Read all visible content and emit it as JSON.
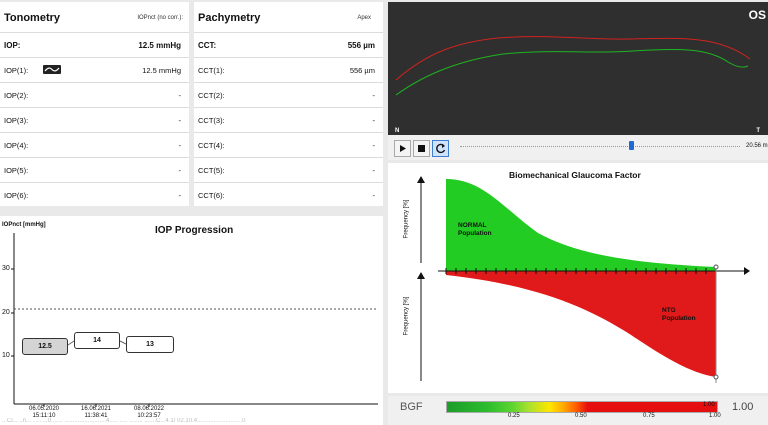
{
  "tonometry": {
    "title": "Tonometry",
    "subtitle": "IOPnct (no corr.):",
    "rows": [
      {
        "label": "IOP:",
        "value": "12.5 mmHg"
      },
      {
        "label": "IOP(1):",
        "value": "12.5 mmHg"
      },
      {
        "label": "IOP(2):",
        "value": "-"
      },
      {
        "label": "IOP(3):",
        "value": "-"
      },
      {
        "label": "IOP(4):",
        "value": "-"
      },
      {
        "label": "IOP(5):",
        "value": "-"
      },
      {
        "label": "IOP(6):",
        "value": "-"
      }
    ]
  },
  "pachymetry": {
    "title": "Pachymetry",
    "subtitle": "Apex",
    "rows": [
      {
        "label": "CCT:",
        "value": "556 µm"
      },
      {
        "label": "CCT(1):",
        "value": "556 µm"
      },
      {
        "label": "CCT(2):",
        "value": "-"
      },
      {
        "label": "CCT(3):",
        "value": "-"
      },
      {
        "label": "CCT(4):",
        "value": "-"
      },
      {
        "label": "CCT(5):",
        "value": "-"
      },
      {
        "label": "CCT(6):",
        "value": "-"
      }
    ]
  },
  "profile_view": {
    "eye_label": "OS",
    "left_marker": "N",
    "right_marker": "T",
    "upper_line_color": "#d0231f",
    "lower_line_color": "#1fb51f"
  },
  "player": {
    "play_icon": "play-icon",
    "stop_icon": "stop-icon",
    "loop_icon": "loop-icon",
    "time_label": "20.56 m",
    "slider_position": 0.61
  },
  "iop_progression": {
    "axis_label": "IOPnct [mmHg]",
    "title": "IOP Progression",
    "y_ticks": [
      "30",
      "20",
      "10"
    ],
    "measurements": [
      {
        "value": "12.5",
        "date": "06.05.2020",
        "time": "15:11:10",
        "selected": true
      },
      {
        "value": "14",
        "date": "16.06.2021",
        "time": "11:38:41",
        "selected": false
      },
      {
        "value": "13",
        "date": "08.06.2022",
        "time": "10:23:57",
        "selected": false
      }
    ]
  },
  "bgf_chart": {
    "title": "Biomechanical Glaucoma Factor",
    "upper_axis_label": "Frequency [%]",
    "lower_axis_label": "Frequency [%]",
    "normal_label_1": "NORMAL",
    "normal_label_2": "Population",
    "ntg_label_1": "NTG",
    "ntg_label_2": "Population",
    "normal_color": "#22cc22",
    "ntg_color": "#e01a1a"
  },
  "bgf_scale": {
    "label": "BGF",
    "ticks": [
      "0.25",
      "0.50",
      "0.75",
      "1.00"
    ],
    "marker_value": "1.00",
    "value": "1.00"
  },
  "footer_text": "...Cl... ..n... . ... ...0....... .........................4..... ..... ........ .......C...4.1/ 02.10.4...........................0"
}
